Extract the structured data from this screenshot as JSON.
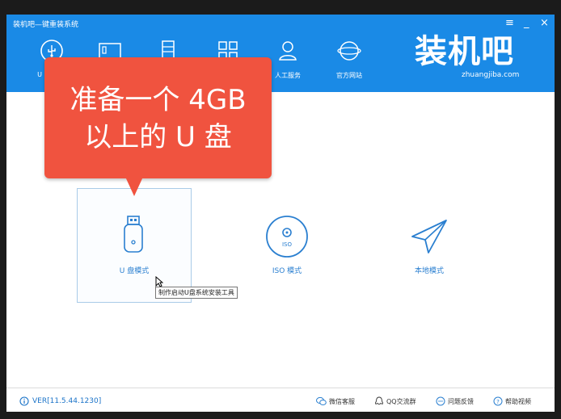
{
  "window": {
    "title": "装机吧—键重装系统"
  },
  "window_controls": {
    "menu": "≡",
    "minimize": "_",
    "close": "×"
  },
  "nav": {
    "items": [
      {
        "label": "U",
        "icon": "usb-icon"
      },
      {
        "label": "",
        "icon": "system-icon"
      },
      {
        "label": "",
        "icon": "document-icon"
      },
      {
        "label": "",
        "icon": "grid-icon"
      },
      {
        "label": "人工服务",
        "icon": "person-icon"
      },
      {
        "label": "官方网站",
        "icon": "globe-icon"
      }
    ]
  },
  "logo": {
    "main": "装机吧",
    "sub": "zhuangjiba.com"
  },
  "callout": {
    "line1": "准备一个 4GB",
    "line2": "以上的 U 盘"
  },
  "modes": [
    {
      "label": "U 盘模式",
      "icon": "usb-drive-icon",
      "selected": true
    },
    {
      "label": "ISO 模式",
      "icon": "disc-icon",
      "selected": false
    },
    {
      "label": "本地模式",
      "icon": "paper-plane-icon",
      "selected": false
    }
  ],
  "tooltip": {
    "text": "制作启动U盘系统安装工具"
  },
  "footer": {
    "version": "VER[11.5.44.1230]",
    "links": [
      {
        "label": "微信客服",
        "icon": "wechat-icon"
      },
      {
        "label": "QQ交流群",
        "icon": "qq-icon"
      },
      {
        "label": "问题反馈",
        "icon": "feedback-icon"
      },
      {
        "label": "帮助视频",
        "icon": "help-icon"
      }
    ]
  },
  "colors": {
    "header": "#1a8ae6",
    "callout": "#f0533f",
    "accent": "#2a7fd0"
  }
}
